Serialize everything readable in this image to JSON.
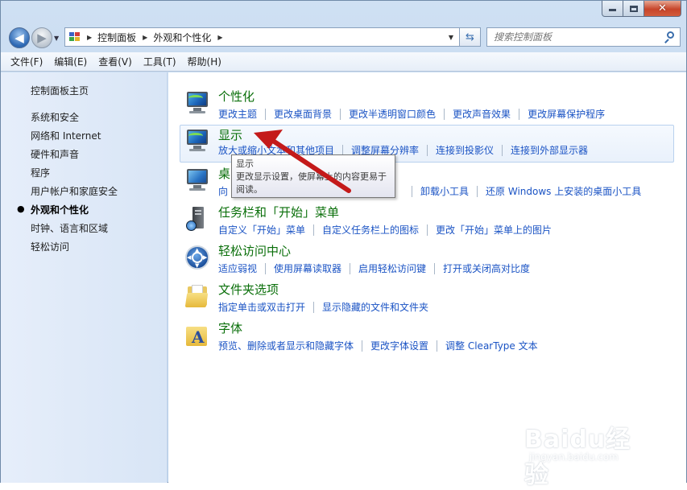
{
  "window": {
    "caption": {
      "minimize_icon": "minimize-icon",
      "maximize_icon": "maximize-icon",
      "close_glyph": "✕"
    }
  },
  "nav": {
    "back_glyph": "◀",
    "forward_glyph": "▶",
    "breadcrumbs": [
      "控制面板",
      "外观和个性化"
    ],
    "refresh_glyph": "⇆",
    "search_placeholder": "搜索控制面板"
  },
  "menu": [
    "文件(F)",
    "编辑(E)",
    "查看(V)",
    "工具(T)",
    "帮助(H)"
  ],
  "sidebar": {
    "home": "控制面板主页",
    "items": [
      "系统和安全",
      "网络和 Internet",
      "硬件和声音",
      "程序",
      "用户帐户和家庭安全",
      "外观和个性化",
      "时钟、语言和区域",
      "轻松访问"
    ],
    "current_index": 5,
    "bullet": "●"
  },
  "categories": [
    {
      "title": "个性化",
      "icon": "personalization-icon",
      "links": [
        "更改主题",
        "更改桌面背景",
        "更改半透明窗口颜色",
        "更改声音效果",
        "更改屏幕保护程序"
      ]
    },
    {
      "title": "显示",
      "icon": "display-icon",
      "links": [
        "放大或缩小文本和其他项目",
        "调整屏幕分辨率",
        "连接到投影仪",
        "连接到外部显示器"
      ]
    },
    {
      "title": "桌",
      "icon": "desktop-gadgets-icon",
      "links": [
        "向",
        "卸载小工具",
        "还原 Windows 上安装的桌面小工具"
      ]
    },
    {
      "title": "任务栏和「开始」菜单",
      "icon": "taskbar-icon",
      "links": [
        "自定义「开始」菜单",
        "自定义任务栏上的图标",
        "更改「开始」菜单上的图片"
      ]
    },
    {
      "title": "轻松访问中心",
      "icon": "ease-of-access-icon",
      "links": [
        "适应弱视",
        "使用屏幕读取器",
        "启用轻松访问键",
        "打开或关闭高对比度"
      ]
    },
    {
      "title": "文件夹选项",
      "icon": "folder-options-icon",
      "links": [
        "指定单击或双击打开",
        "显示隐藏的文件和文件夹"
      ]
    },
    {
      "title": "字体",
      "icon": "fonts-icon",
      "links": [
        "预览、删除或者显示和隐藏字体",
        "更改字体设置",
        "调整 ClearType 文本"
      ]
    }
  ],
  "tooltip": {
    "title": "显示",
    "body": "更改显示设置，使屏幕上的内容更易于阅读。"
  },
  "watermark": {
    "logo": "Baidu经验",
    "url": "jingyan.baidu.com"
  },
  "colors": {
    "link": "#1a53c4",
    "category_title": "#0a6f0a",
    "annotation_arrow": "#c41a1a"
  }
}
